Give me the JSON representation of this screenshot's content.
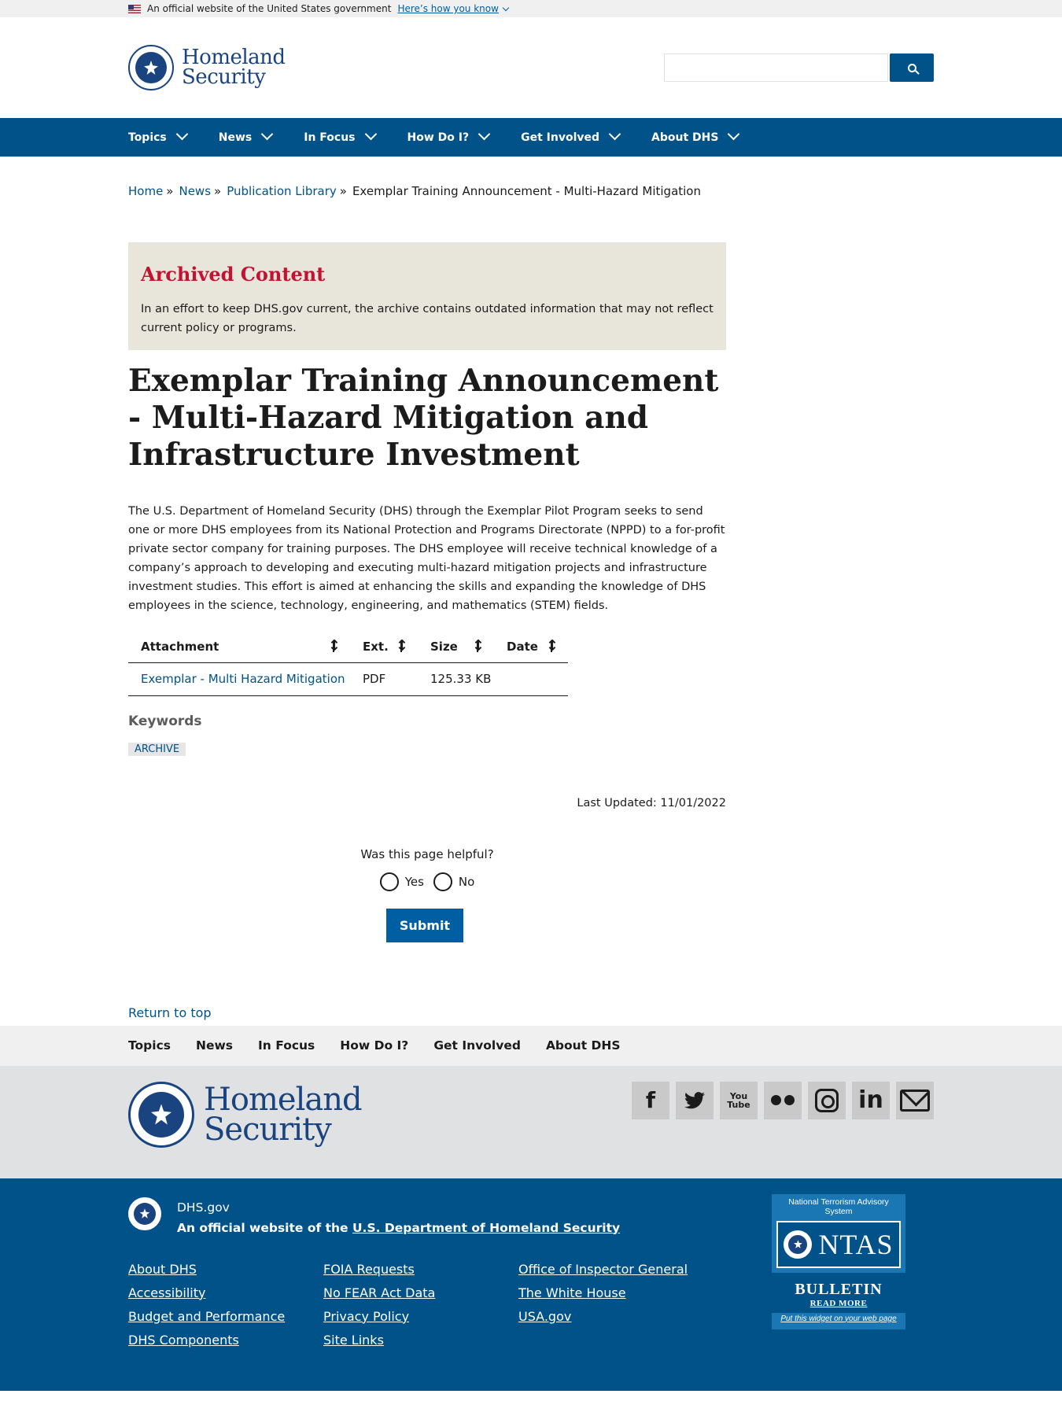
{
  "gov_banner": {
    "text": "An official website of the United States government",
    "link": "Here’s how you know"
  },
  "header": {
    "logo_line1": "Homeland",
    "logo_line2": "Security",
    "search_placeholder": ""
  },
  "nav": {
    "items": [
      "Topics",
      "News",
      "In Focus",
      "How Do I?",
      "Get Involved",
      "About DHS"
    ]
  },
  "breadcrumb": {
    "items": [
      "Home",
      "News",
      "Publication Library"
    ],
    "current": "Exemplar Training Announcement - Multi-Hazard Mitigation",
    "separator": "»"
  },
  "archived": {
    "title": "Archived Content",
    "text": "In an effort to keep DHS.gov current, the archive contains outdated information that may not reflect current policy or programs."
  },
  "page": {
    "title": "Exemplar Training Announcement - Multi-Hazard Mitigation and Infrastructure Investment",
    "body": "The U.S. Department of Homeland Security (DHS) through the Exemplar Pilot Program seeks to send one or more DHS employees from its National Protection and Programs Directorate (NPPD) to a for-profit private sector company for training purposes. The DHS employee will receive technical knowledge of a company’s approach to developing and executing multi-hazard mitigation projects and infrastructure investment studies. This effort is aimed at enhancing the skills and expanding the knowledge of DHS employees in the science, technology, engineering, and mathematics (STEM) fields."
  },
  "attachments": {
    "headers": [
      "Attachment",
      "Ext.",
      "Size",
      "Date"
    ],
    "rows": [
      {
        "name": "Exemplar - Multi Hazard Mitigation",
        "ext": "PDF",
        "size": "125.33 KB",
        "date": ""
      }
    ]
  },
  "keywords": {
    "heading": "Keywords",
    "tags": [
      "ARCHIVE"
    ]
  },
  "last_updated": "Last Updated: 11/01/2022",
  "feedback": {
    "question": "Was this page helpful?",
    "yes": "Yes",
    "no": "No",
    "submit": "Submit"
  },
  "return_to_top": "Return to top",
  "footer_nav": {
    "items": [
      "Topics",
      "News",
      "In Focus",
      "How Do I?",
      "Get Involved",
      "About DHS"
    ]
  },
  "footer_logo": {
    "line1": "Homeland",
    "line2": "Security"
  },
  "socials": [
    "facebook-icon",
    "twitter-icon",
    "youtube-icon",
    "flickr-icon",
    "instagram-icon",
    "linkedin-icon",
    "email-icon"
  ],
  "footer_bottom": {
    "site": "DHS.gov",
    "official_prefix": "An official website of the",
    "official_link": "U.S. Department of Homeland Security",
    "links_col1": [
      "About DHS",
      "Accessibility",
      "Budget and Performance",
      "DHS Components"
    ],
    "links_col2": [
      "FOIA Requests",
      "No FEAR Act Data",
      "Privacy Policy",
      "Site Links"
    ],
    "links_col3": [
      "Office of Inspector General",
      "The White House",
      "USA.gov"
    ]
  },
  "ntas": {
    "top_text": "National Terrorism Advisory System",
    "name": "NTAS",
    "bulletin": "BULLETIN",
    "read_more": "READ MORE",
    "widget_text": "Put this widget on your web page"
  },
  "colors": {
    "primary": "#005288",
    "alert_red": "#c41230",
    "archive_bg": "#e8e5da"
  }
}
